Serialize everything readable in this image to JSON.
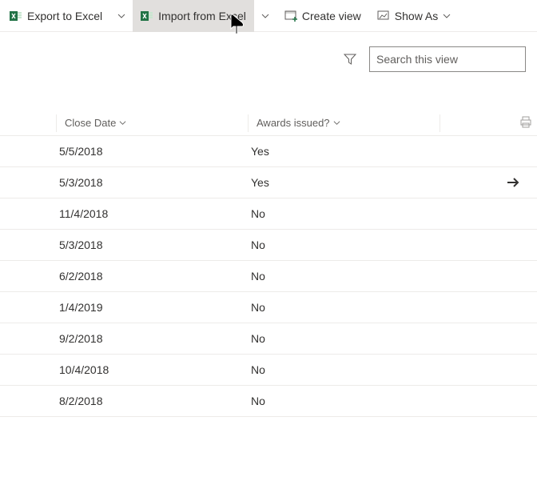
{
  "toolbar": {
    "export_label": "Export to Excel",
    "import_label": "Import from Excel",
    "create_view_label": "Create view",
    "show_as_label": "Show As"
  },
  "search": {
    "placeholder": "Search this view"
  },
  "columns": {
    "close_date_label": "Close Date",
    "awards_issued_label": "Awards issued?"
  },
  "rows": [
    {
      "close_date": "5/5/2018",
      "awards_issued": "Yes",
      "action": ""
    },
    {
      "close_date": "5/3/2018",
      "awards_issued": "Yes",
      "action": "arrow"
    },
    {
      "close_date": "11/4/2018",
      "awards_issued": "No",
      "action": ""
    },
    {
      "close_date": "5/3/2018",
      "awards_issued": "No",
      "action": ""
    },
    {
      "close_date": "6/2/2018",
      "awards_issued": "No",
      "action": ""
    },
    {
      "close_date": "1/4/2019",
      "awards_issued": "No",
      "action": ""
    },
    {
      "close_date": "9/2/2018",
      "awards_issued": "No",
      "action": ""
    },
    {
      "close_date": "10/4/2018",
      "awards_issued": "No",
      "action": ""
    },
    {
      "close_date": "8/2/2018",
      "awards_issued": "No",
      "action": ""
    }
  ]
}
